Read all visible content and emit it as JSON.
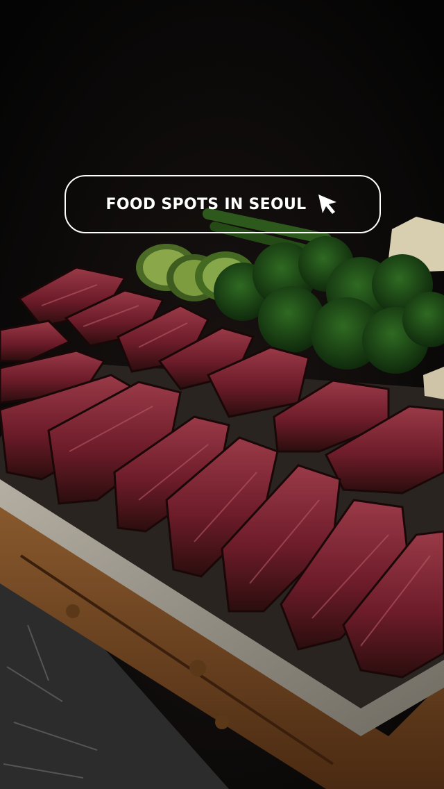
{
  "overlay": {
    "title": "FOOD SPOTS IN SEOUL",
    "icon": "cursor-arrow-icon",
    "text_color": "#ffffff"
  },
  "photo": {
    "subject": "sliced steak on stone plate",
    "background_color": "#050505",
    "meat_color": "#7a1f2c",
    "greens_color": "#1f4a18",
    "zucchini_color": "#6a8c3a",
    "wood_color": "#7a4a22",
    "stone_color": "#9a968c"
  }
}
